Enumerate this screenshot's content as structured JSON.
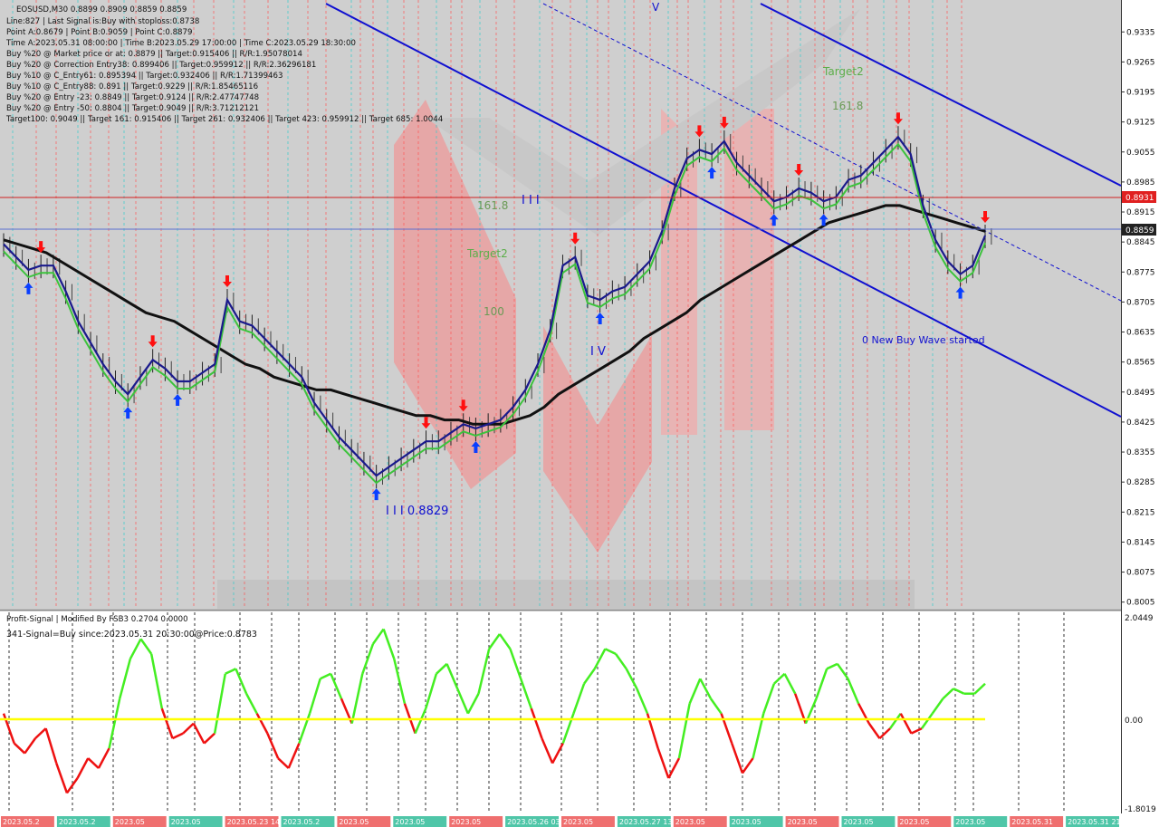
{
  "window": {
    "symbol_line": "EOSUSD,M30  0.8899 0.8909 0.8859 0.8859"
  },
  "info_lines": [
    "Line:827 | Last Signal is:Buy with stoploss:0.8738",
    "Point A:0.8679 | Point B:0.9059 | Point C:0.8879",
    "Time A:2023.05.31 08:00:00 | Time B:2023.05.29 17:00:00 | Time C:2023.05.29 18:30:00",
    "Buy %20 @ Market price or at: 0.8879 || Target:0.915406 || R/R:1.95078014",
    "Buy %20 @ Correction Entry38: 0.899406 || Target:0.959912 || R/R:2.36296181",
    "Buy %10 @ C_Entry61: 0.895394 || Target:0.932406 || R/R:1.71399463",
    "Buy %10 @ C_Entry88: 0.891 || Target:0.9229 || R/R:1.85465116",
    "Buy %20 @ Entry -23: 0.8849 || Target:0.9124 || R/R:2.47747748",
    "Buy %20 @ Entry -50: 0.8804 || Target:0.9049 || R/R:3.71212121",
    "Target100: 0.9049 || Target 161: 0.915406 || Target 261: 0.932406 || Target 423: 0.959912 || Target 685: 1.0044"
  ],
  "annotations": {
    "fib_161_left": "161.8",
    "target2_left": "Target2",
    "fib_100": "100",
    "wave_iii_top": "I I I",
    "wave_iii_low": "I I I 0.8829",
    "wave_iv": "I V",
    "wave_v": "V",
    "target2_right": "Target2",
    "fib_161_right": "161.8",
    "new_wave": "0 New Buy Wave started"
  },
  "price_tags": {
    "red": "0.8931",
    "current": "0.8859"
  },
  "indicator": {
    "title": "Profit-Signal | Modified By FSB3 0.2704 0.0000",
    "signal_text": "341-Signal=Buy since:2023.05.31 20:30:00@Price:0.8783",
    "top_label": "2.0449",
    "zero_label": "0.00",
    "bottom_label": "-1.8019"
  },
  "time_labels": [
    "2023.05.2",
    "2023.05.2",
    "2023.05",
    "2023.05",
    "2023.05.23 14:00",
    "2023.05.2",
    "2023.05",
    "2023.05",
    "2023.05",
    "2023.05.26 03:30",
    "2023.05",
    "2023.05.27 13:00",
    "2023.05",
    "2023.05",
    "2023.05",
    "2023.05",
    "2023.05",
    "2023.05",
    "2023.05.31",
    "2023.05.31 21:00"
  ],
  "colors": {
    "background": "#cfcfcf",
    "buy_arrow": "#0a3fff",
    "sell_arrow": "#ff1010",
    "ma_slow": "#111111",
    "ma_mid": "#3cc33c",
    "ma_fast": "#1a1a8c",
    "channel": "#1010d0",
    "osc_up": "#44ee22",
    "osc_down": "#ee1111",
    "zero_line": "#ffff00"
  },
  "chart_data": [
    {
      "type": "line",
      "title": "EOSUSD,M30",
      "ylim": [
        0.7998,
        0.9363
      ],
      "y_ticks": [
        0.9335,
        0.9265,
        0.9195,
        0.9125,
        0.9055,
        0.8985,
        0.8915,
        0.8845,
        0.8775,
        0.8705,
        0.8635,
        0.8565,
        0.8495,
        0.8425,
        0.8355,
        0.8285,
        0.8215,
        0.8145,
        0.8075,
        0.8005
      ],
      "series": [
        {
          "name": "",
          "values": [
            0.884,
            0.881,
            0.878,
            0.879,
            0.879,
            0.873,
            0.866,
            0.861,
            0.856,
            0.852,
            0.849,
            0.853,
            0.857,
            0.855,
            0.852,
            0.852,
            0.854,
            0.856,
            0.871,
            0.866,
            0.865,
            0.862,
            0.859,
            0.856,
            0.853,
            0.847,
            0.843,
            0.839,
            0.836,
            0.833,
            0.83,
            0.832,
            0.834,
            0.836,
            0.838,
            0.838,
            0.84,
            0.842,
            0.841,
            0.842,
            0.843,
            0.846,
            0.85,
            0.856,
            0.864,
            0.879,
            0.881,
            0.872,
            0.871,
            0.873,
            0.874,
            0.877,
            0.88,
            0.887,
            0.897,
            0.904,
            0.906,
            0.905,
            0.908,
            0.903,
            0.9,
            0.897,
            0.894,
            0.895,
            0.897,
            0.896,
            0.894,
            0.895,
            0.899,
            0.9,
            0.903,
            0.906,
            0.909,
            0.905,
            0.893,
            0.885,
            0.88,
            0.877,
            0.879,
            0.886
          ]
        },
        {
          "name": "",
          "values": [
            0.885,
            0.884,
            0.883,
            0.882,
            0.88,
            0.878,
            0.876,
            0.874,
            0.872,
            0.87,
            0.868,
            0.867,
            0.866,
            0.864,
            0.862,
            0.86,
            0.858,
            0.856,
            0.855,
            0.853,
            0.852,
            0.851,
            0.85,
            0.85,
            0.849,
            0.848,
            0.847,
            0.846,
            0.845,
            0.844,
            0.844,
            0.843,
            0.843,
            0.842,
            0.842,
            0.842,
            0.843,
            0.844,
            0.846,
            0.849,
            0.851,
            0.853,
            0.855,
            0.857,
            0.859,
            0.862,
            0.864,
            0.866,
            0.868,
            0.871,
            0.873,
            0.875,
            0.877,
            0.879,
            0.881,
            0.883,
            0.885,
            0.887,
            0.889,
            0.89,
            0.891,
            0.892,
            0.893,
            0.893,
            0.892,
            0.891,
            0.89,
            0.889,
            0.888,
            0.887
          ]
        }
      ]
    },
    {
      "type": "line",
      "title": "Profit-Signal | Modified By FSB3 0.2704 0.0000",
      "ylim": [
        -1.8019,
        2.0449
      ],
      "series": [
        {
          "name": "",
          "values": [
            0.1,
            -0.5,
            -0.7,
            -0.4,
            -0.2,
            -0.9,
            -1.5,
            -1.2,
            -0.8,
            -1.0,
            -0.6,
            0.4,
            1.2,
            1.6,
            1.3,
            0.2,
            -0.4,
            -0.3,
            -0.1,
            -0.5,
            -0.3,
            0.9,
            1.0,
            0.5,
            0.1,
            -0.3,
            -0.8,
            -1.0,
            -0.5,
            0.1,
            0.8,
            0.9,
            0.4,
            -0.1,
            0.9,
            1.5,
            1.8,
            1.2,
            0.3,
            -0.3,
            0.2,
            0.9,
            1.1,
            0.6,
            0.1,
            0.5,
            1.4,
            1.7,
            1.4,
            0.8,
            0.2,
            -0.4,
            -0.9,
            -0.5,
            0.1,
            0.7,
            1.0,
            1.4,
            1.3,
            1.0,
            0.6,
            0.1,
            -0.6,
            -1.2,
            -0.8,
            0.3,
            0.8,
            0.4,
            0.1,
            -0.5,
            -1.1,
            -0.8,
            0.1,
            0.7,
            0.9,
            0.5,
            -0.1,
            0.4,
            1.0,
            1.1,
            0.8,
            0.3,
            -0.1,
            -0.4,
            -0.2,
            0.1,
            -0.3,
            -0.2,
            0.1,
            0.4,
            0.6,
            0.5,
            0.5,
            0.7
          ]
        }
      ]
    }
  ]
}
